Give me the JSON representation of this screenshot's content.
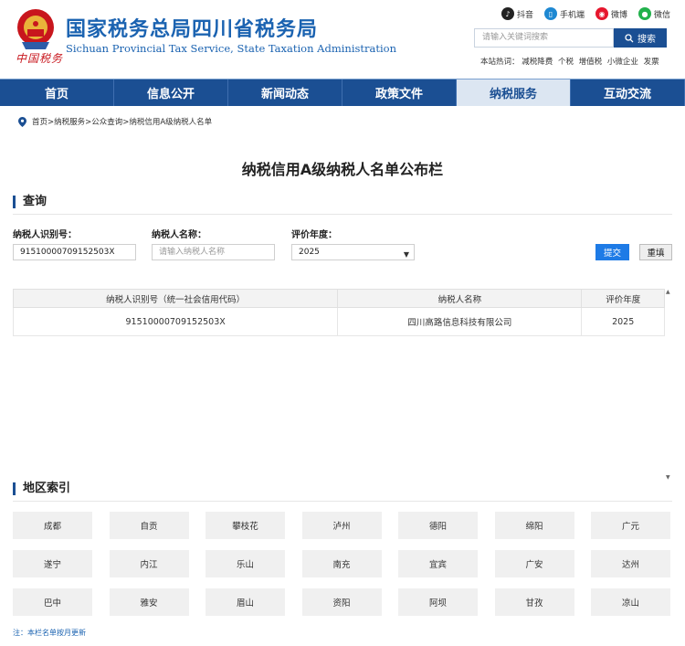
{
  "header": {
    "title": "国家税务总局四川省税务局",
    "subtitle": "Sichuan Provincial Tax Service, State Taxation Administration",
    "logo_script": "中国税务",
    "social": [
      {
        "label": "抖音",
        "icon": "tiktok-icon",
        "color": "#222222"
      },
      {
        "label": "手机端",
        "icon": "mobile-icon",
        "color": "#1e88d2"
      },
      {
        "label": "微博",
        "icon": "weibo-icon",
        "color": "#e6162d"
      },
      {
        "label": "微信",
        "icon": "wechat-icon",
        "color": "#22b14c"
      }
    ],
    "search_placeholder": "请输入关键词搜索",
    "search_button": "搜索",
    "hot_label": "本站热词：",
    "hot_words": [
      "减税降费",
      "个税",
      "增值税",
      "小微企业",
      "发票"
    ]
  },
  "nav": {
    "items": [
      "首页",
      "信息公开",
      "新闻动态",
      "政策文件",
      "纳税服务",
      "互动交流"
    ],
    "active_index": 4
  },
  "breadcrumb": "首页>纳税服务>公众查询>纳税信用A级纳税人名单",
  "page_title": "纳税信用A级纳税人名单公布栏",
  "query": {
    "heading": "查询",
    "taxpayer_id_label": "纳税人识别号：",
    "taxpayer_id_value": "91510000709152503X",
    "taxpayer_name_label": "纳税人名称：",
    "taxpayer_name_placeholder": "请输入纳税人名称",
    "year_label": "评价年度：",
    "year_value": "2025",
    "submit": "提交",
    "reset": "重填"
  },
  "table": {
    "headers": [
      "纳税人识别号（统一社会信用代码）",
      "纳税人名称",
      "评价年度"
    ],
    "rows": [
      [
        "91510000709152503X",
        "四川高路信息科技有限公司",
        "2025"
      ]
    ]
  },
  "regions": {
    "heading": "地区索引",
    "items": [
      "成都",
      "自贡",
      "攀枝花",
      "泸州",
      "德阳",
      "绵阳",
      "广元",
      "遂宁",
      "内江",
      "乐山",
      "南充",
      "宜宾",
      "广安",
      "达州",
      "巴中",
      "雅安",
      "眉山",
      "资阳",
      "阿坝",
      "甘孜",
      "凉山"
    ]
  },
  "note": "注：本栏名单按月更新",
  "colors": {
    "brand": "#1b4f93",
    "title": "#1b63b1",
    "submit": "#1e7be6",
    "logo_red": "#c8161d"
  }
}
